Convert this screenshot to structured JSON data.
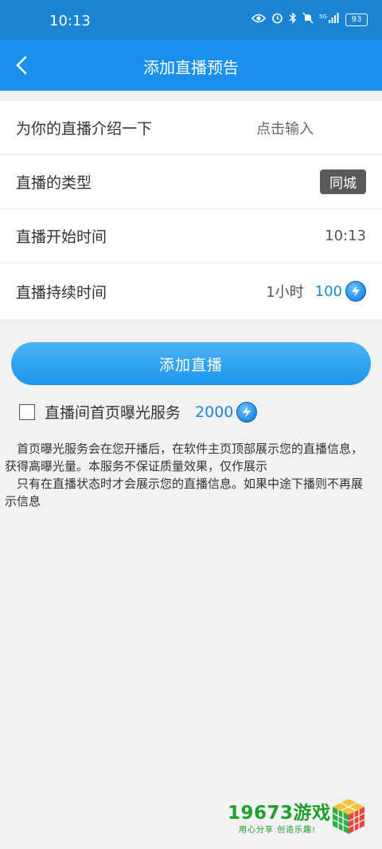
{
  "status_bar": {
    "time": "10:13",
    "battery": "93",
    "network": "5G"
  },
  "header": {
    "title": "添加直播预告"
  },
  "form": {
    "intro": {
      "label": "为你的直播介绍一下",
      "placeholder": "点击输入"
    },
    "type": {
      "label": "直播的类型",
      "value": "同城"
    },
    "start_time": {
      "label": "直播开始时间",
      "value": "10:13"
    },
    "duration": {
      "label": "直播持续时间",
      "value": "1小时",
      "price": "100"
    }
  },
  "add_button": {
    "label": "添加直播"
  },
  "exposure": {
    "label": "直播间首页曝光服务",
    "price": "2000",
    "checked": false
  },
  "description": "　首页曝光服务会在您开播后，在软件主页顶部展示您的直播信息，获得高曝光量。本服务不保证质量效果，仅作展示\n　只有在直播状态时才会展示您的直播信息。如果中途下播则不再展示信息",
  "watermark": {
    "brand": "19673游戏",
    "slogan": "用心分享  创造乐趣!"
  },
  "colors": {
    "appbar": "#1a90ee",
    "statusbar": "#1b83d4",
    "accent": "#1a85d6",
    "button": "#2a9ff0"
  }
}
